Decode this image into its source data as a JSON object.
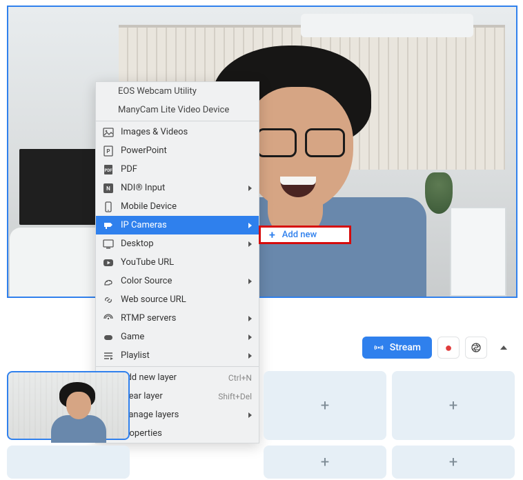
{
  "menu": {
    "header1": "EOS Webcam Utility",
    "header2": "ManyCam Lite Video Device",
    "items": {
      "images": "Images & Videos",
      "powerpoint": "PowerPoint",
      "pdf": "PDF",
      "ndi": "NDI® Input",
      "mobile": "Mobile Device",
      "ipcameras": "IP Cameras",
      "desktop": "Desktop",
      "youtube": "YouTube URL",
      "color": "Color Source",
      "web": "Web source URL",
      "rtmp": "RTMP servers",
      "game": "Game",
      "playlist": "Playlist",
      "addlayer": "Add new layer",
      "clearlayer": "Clear layer",
      "managelayers": "Manage layers",
      "properties": "Properties"
    },
    "shortcuts": {
      "addlayer": "Ctrl+N",
      "clearlayer": "Shift+Del"
    }
  },
  "submenu": {
    "addnew": "Add new"
  },
  "toolbar": {
    "stream": "Stream"
  }
}
